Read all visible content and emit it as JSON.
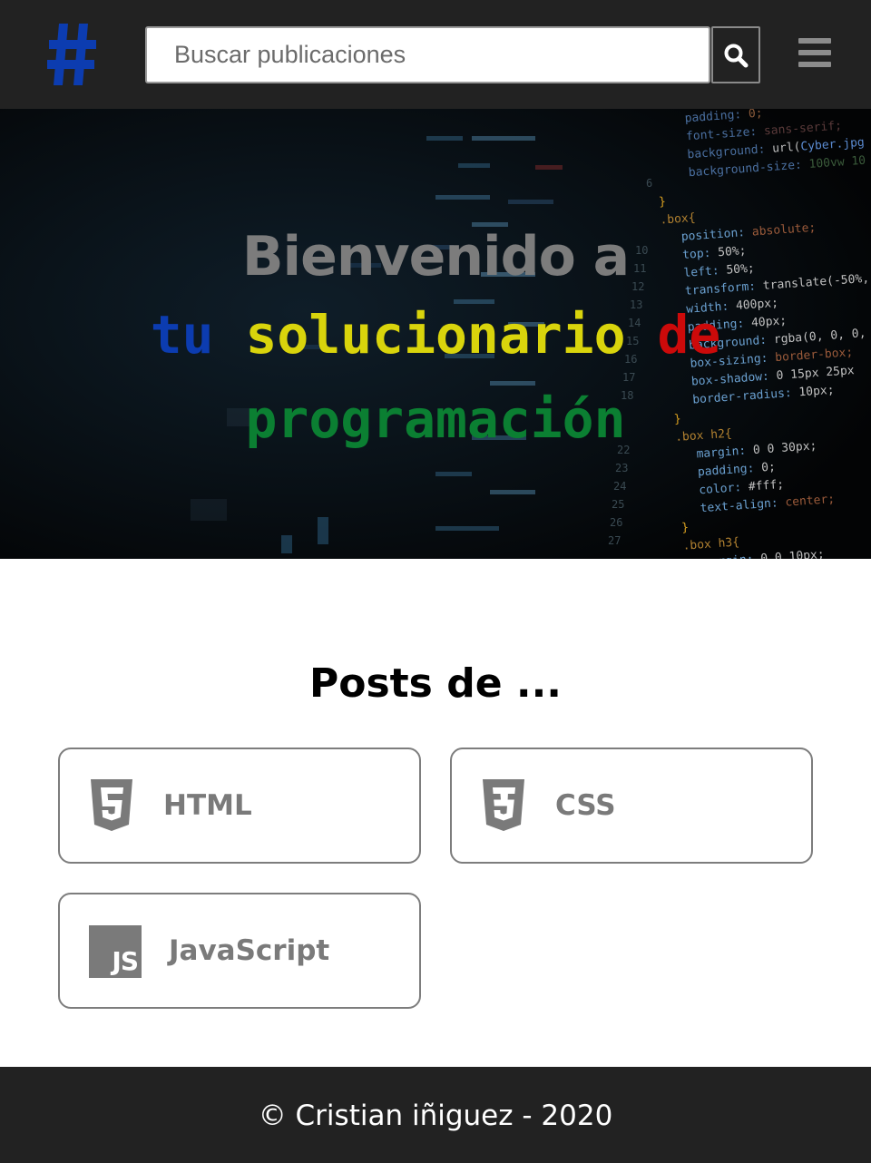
{
  "header": {
    "logo_icon": "hashtag-logo-icon",
    "search_placeholder": "Buscar publicaciones",
    "search_button_icon": "search-icon",
    "menu_icon": "hamburger-menu-icon"
  },
  "hero": {
    "title": "Bienvenido a",
    "line2": {
      "word1": "tu",
      "word2": "solucionario",
      "word3": "de"
    },
    "line3": "programación",
    "colors": {
      "tu": "#0c3cb0",
      "solucionario": "#d9d40c",
      "de": "#cc0a0a",
      "programacion": "#0b7f32"
    }
  },
  "posts": {
    "title": "Posts de ...",
    "cards": [
      {
        "label": "HTML",
        "icon": "html5-icon"
      },
      {
        "label": "CSS",
        "icon": "css3-icon"
      },
      {
        "label": "JavaScript",
        "icon": "javascript-icon",
        "icon_text": "JS"
      }
    ]
  },
  "footer": {
    "text": "© Cristian iñiguez - 2020"
  },
  "colors": {
    "header_bg": "#222222",
    "footer_bg": "#222222",
    "card_text": "#7a7a7a",
    "accent_blue": "#0c3cb0"
  }
}
